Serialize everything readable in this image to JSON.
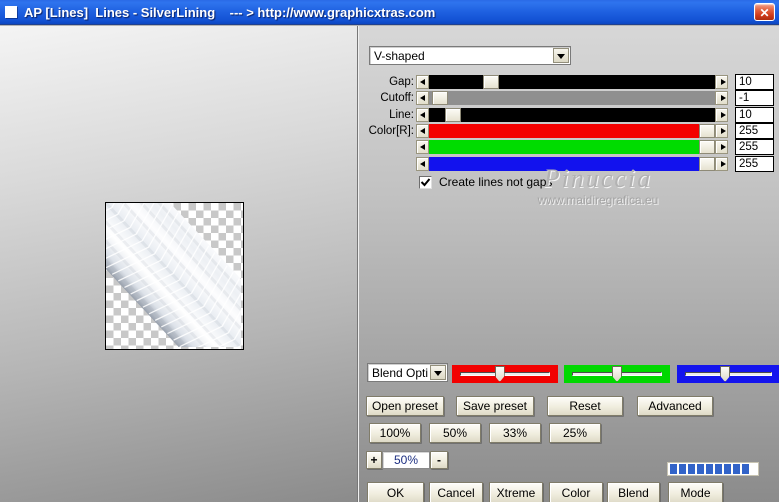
{
  "title_bar": {
    "title": "AP [Lines]  Lines - SilverLining    --- > http://www.graphicxtras.com",
    "close": "✕"
  },
  "colors": {
    "titlebar_blue": "#1e60e0",
    "progress_segment": "#3263c8"
  },
  "controls": {
    "shape_dropdown": {
      "value": "V-shaped"
    },
    "sliders": [
      {
        "id": "gap",
        "label": "Gap:",
        "value": "10",
        "track_color": "#000000",
        "thumb_pct": 20
      },
      {
        "id": "cutoff",
        "label": "Cutoff:",
        "value": "-1",
        "track_color": "#8f8f8f",
        "thumb_pct": 1
      },
      {
        "id": "line",
        "label": "Line:",
        "value": "10",
        "track_color": "#000000",
        "thumb_pct": 6
      },
      {
        "id": "color-r",
        "label": "Color[R]:",
        "value": "255",
        "track_color": "#f40000",
        "thumb_pct": 100
      },
      {
        "id": "color-g",
        "label": "",
        "value": "255",
        "track_color": "#00dc00",
        "thumb_pct": 100
      },
      {
        "id": "color-b",
        "label": "",
        "value": "255",
        "track_color": "#1212ee",
        "thumb_pct": 100
      }
    ],
    "checkbox": {
      "label": "Create lines not gaps",
      "checked": true
    },
    "blend_dropdown": {
      "value": "Blend Opti"
    },
    "channel_trackbars": [
      {
        "id": "red",
        "color": "#f20000",
        "thumb_pct": 44
      },
      {
        "id": "green",
        "color": "#00d800",
        "thumb_pct": 50
      },
      {
        "id": "blue",
        "color": "#1414ee",
        "thumb_pct": 46
      }
    ],
    "preset_buttons": [
      "Open preset",
      "Save preset",
      "Reset",
      "Advanced"
    ],
    "zoom_buttons": [
      "100%",
      "50%",
      "33%",
      "25%"
    ],
    "zoom_stepper": {
      "plus": "+",
      "value": "50%",
      "minus": "-"
    },
    "progress": {
      "segments": 9
    },
    "action_buttons": [
      "OK",
      "Cancel",
      "Xtreme",
      "Color",
      "Blend",
      "Mode"
    ]
  },
  "watermark": {
    "line1": "Pinuccia",
    "line2": "www.maidiregrafica.eu"
  }
}
